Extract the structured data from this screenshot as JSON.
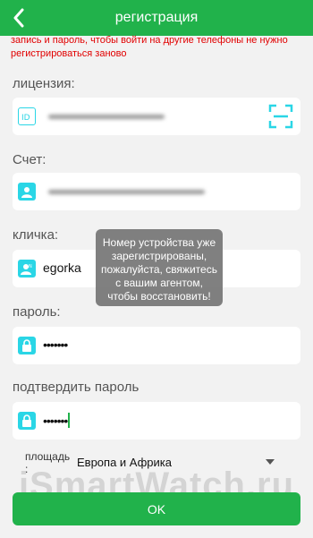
{
  "header": {
    "title": "регистрация"
  },
  "warning": "запись и пароль, чтобы войти на другие телефоны не нужно регистрироваться заново",
  "fields": {
    "license": {
      "label": "лицензия:",
      "value": ""
    },
    "account": {
      "label": "Счет:",
      "value": ""
    },
    "nickname": {
      "label": "кличка:",
      "value": "egorka"
    },
    "password": {
      "label": "пароль:",
      "value": "•••••••"
    },
    "confirm": {
      "label": "подтвердить пароль",
      "value": "•••••••"
    }
  },
  "area": {
    "label_line1": "площадь",
    "label_line2": ":",
    "value": "Европа и Африка"
  },
  "toast": {
    "lines": [
      "Номер устройства уже",
      "зарегистрированы,",
      "пожалуйста, свяжитесь",
      "с вашим агентом,",
      "чтобы восстановить!"
    ]
  },
  "watermark": "iSmartWatch.ru",
  "ok_label": "OK",
  "colors": {
    "accent": "#21b24b",
    "warning": "#e10000",
    "icon": "#2ad6e6"
  }
}
